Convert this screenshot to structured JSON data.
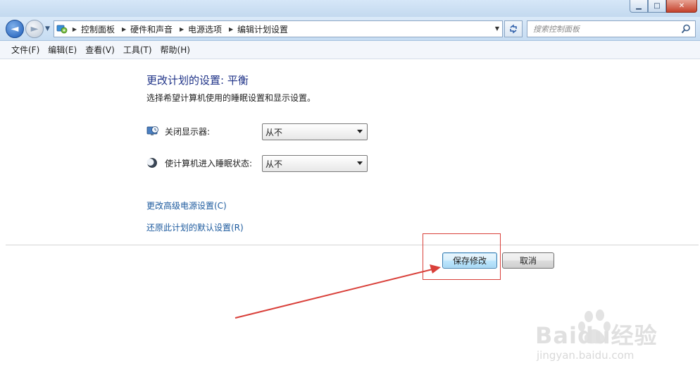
{
  "window": {
    "minimize_glyph": "▁",
    "maximize_glyph": "□",
    "close_glyph": "✕"
  },
  "nav": {
    "back_glyph": "◄",
    "forward_glyph": "►"
  },
  "breadcrumbs": [
    "控制面板",
    "硬件和声音",
    "电源选项",
    "编辑计划设置"
  ],
  "search": {
    "placeholder": "搜索控制面板"
  },
  "menu": [
    "文件(F)",
    "编辑(E)",
    "查看(V)",
    "工具(T)",
    "帮助(H)"
  ],
  "page": {
    "title": "更改计划的设置: 平衡",
    "description": "选择希望计算机使用的睡眠设置和显示设置。"
  },
  "settings": {
    "display_off": {
      "label": "关闭显示器:",
      "value": "从不"
    },
    "sleep": {
      "label": "使计算机进入睡眠状态:",
      "value": "从不"
    }
  },
  "links": {
    "advanced": "更改高级电源设置(C)",
    "restore": "还原此计划的默认设置(R)"
  },
  "buttons": {
    "save": "保存修改",
    "cancel": "取消"
  },
  "watermark": {
    "brand": "Baidu经验",
    "url": "jingyan.baidu.com"
  },
  "colors": {
    "title": "#1e3287",
    "link": "#1c5a9e",
    "annotation": "#d9403a"
  },
  "icons": [
    "control-panel-icon",
    "search-icon",
    "monitor-clock-icon",
    "moon-sleep-icon",
    "refresh-icon"
  ]
}
